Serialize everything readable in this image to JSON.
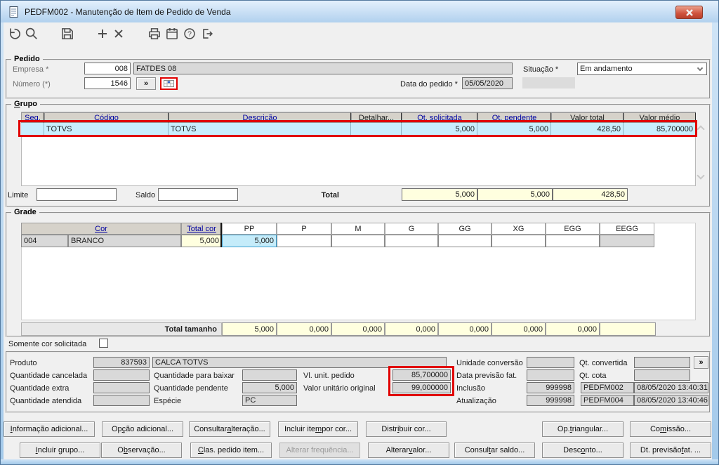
{
  "window": {
    "title": "PEDFM002 - Manutenção de Item de Pedido de Venda"
  },
  "toolbar": {
    "icons": [
      "undo",
      "search",
      "save",
      "add",
      "delete",
      "print",
      "calendar",
      "help",
      "exit"
    ]
  },
  "pedido": {
    "legend": "Pedido",
    "empresa_label": "Empresa *",
    "empresa_codigo": "008",
    "empresa_nome": "FATDES 08",
    "numero_label": "Número (*)",
    "numero_valor": "1546",
    "expand_label": "»",
    "data_pedido_label": "Data do pedido *",
    "data_pedido": "05/05/2020",
    "situacao_label": "Situação *",
    "situacao": "Em andamento"
  },
  "grupo": {
    "legend": {
      "label": "Grupo",
      "accel": 0
    },
    "headers": [
      "Seq.",
      "Código",
      "Descrição",
      "Detalhar...",
      "Qt. solicitada",
      "Qt. pendente",
      "Valor total",
      "Valor médio"
    ],
    "row": {
      "codigo": "TOTVS",
      "descricao": "TOTVS",
      "qt_solicitada": "5,000",
      "qt_pendente": "5,000",
      "valor_total": "428,50",
      "valor_medio": "85,700000"
    },
    "limite_label": "Limite",
    "saldo_label": "Saldo",
    "total_label": "Total",
    "total_qt_solicitada": "5,000",
    "total_qt_pendente": "5,000",
    "total_valor": "428,50"
  },
  "grade": {
    "legend": "Grade",
    "cor_header": "Cor",
    "total_cor_header": "Total cor",
    "size_headers": [
      "PP",
      "P",
      "M",
      "G",
      "GG",
      "XG",
      "EGG",
      "EEGG"
    ],
    "row": {
      "codigo": "004",
      "cor": "BRANCO",
      "total_cor": "5,000",
      "pp": "5,000"
    },
    "total_tamanho_label": "Total tamanho",
    "totais_tamanho": [
      "5,000",
      "0,000",
      "0,000",
      "0,000",
      "0,000",
      "0,000",
      "0,000"
    ],
    "somente_cor_label": "Somente cor solicitada"
  },
  "detalhes": {
    "produto_label": "Produto",
    "produto_codigo": "837593",
    "produto_descricao": "CALCA TOTVS",
    "qtd_cancelada_label": "Quantidade cancelada",
    "qtd_extra_label": "Quantidade extra",
    "qtd_atendida_label": "Quantidade atendida",
    "qtd_baixar_label": "Quantidade para baixar",
    "qtd_pendente_label": "Quantidade pendente",
    "qtd_pendente": "5,000",
    "especie_label": "Espécie",
    "especie": "PC",
    "vl_unit_label": "Vl. unit. pedido",
    "vl_unit": "85,700000",
    "vl_orig_label": "Valor unitário original",
    "vl_orig": "99,000000",
    "unidade_conv_label": "Unidade conversão",
    "data_prev_label": "Data previsão fat.",
    "inclusao_label": "Inclusão",
    "inclusao_usuario": "999998",
    "inclusao_programa": "PEDFM002",
    "inclusao_datahora": "08/05/2020 13:40:31",
    "atualizacao_label": "Atualização",
    "atualizacao_usuario": "999998",
    "atualizacao_programa": "PEDFM004",
    "atualizacao_datahora": "08/05/2020 13:40:46",
    "qt_convertida_label": "Qt. convertida",
    "qt_cota_label": "Qt. cota",
    "expand_label": "»"
  },
  "buttons": {
    "row1": [
      {
        "label": "Informação adicional...",
        "accel": 0
      },
      {
        "label": "Opção adicional...",
        "accel": 2
      },
      {
        "label": "Consultar alteração...",
        "accel": 10
      },
      {
        "label": "Incluir item por cor...",
        "accel": 11
      },
      {
        "label": "Distribuir cor...",
        "accel": 5
      },
      {
        "label": "Op. triangular...",
        "accel": 4
      },
      {
        "label": "Comissão...",
        "accel": 2
      }
    ],
    "row2": [
      {
        "label": "Incluir grupo...",
        "accel": 0
      },
      {
        "label": "Observação...",
        "accel": 1
      },
      {
        "label": "Clas. pedido item...",
        "accel": 0
      },
      {
        "label": "Alterar frequência...",
        "accel": -1
      },
      {
        "label": "Alterar valor...",
        "accel": 8
      },
      {
        "label": "Consultar saldo...",
        "accel": 6
      },
      {
        "label": "Desconto...",
        "accel": 4
      },
      {
        "label": "Dt. previsão fat. ...",
        "accel": 13
      }
    ]
  }
}
